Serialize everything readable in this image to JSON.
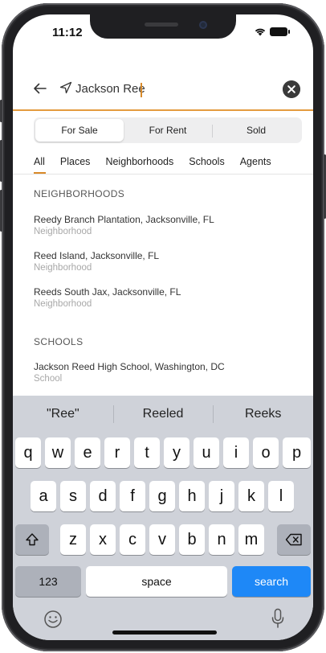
{
  "status_bar": {
    "time": "11:12"
  },
  "search": {
    "value": "Jackson Ree"
  },
  "segments": [
    {
      "label": "For Sale",
      "active": true
    },
    {
      "label": "For Rent",
      "active": false
    },
    {
      "label": "Sold",
      "active": false
    }
  ],
  "tabs": [
    {
      "label": "All",
      "active": true
    },
    {
      "label": "Places",
      "active": false
    },
    {
      "label": "Neighborhoods",
      "active": false
    },
    {
      "label": "Schools",
      "active": false
    },
    {
      "label": "Agents",
      "active": false
    }
  ],
  "sections": {
    "neighborhoods": {
      "heading": "NEIGHBORHOODS",
      "items": [
        {
          "title": "Reedy Branch Plantation, Jacksonville, FL",
          "type": "Neighborhood"
        },
        {
          "title": "Reed Island, Jacksonville, FL",
          "type": "Neighborhood"
        },
        {
          "title": "Reeds South Jax, Jacksonville, FL",
          "type": "Neighborhood"
        }
      ]
    },
    "schools": {
      "heading": "SCHOOLS",
      "items": [
        {
          "title": "Jackson Reed High School, Washington, DC",
          "type": "School"
        }
      ]
    }
  },
  "keyboard": {
    "suggestions": [
      "\"Ree\"",
      "Reeled",
      "Reeks"
    ],
    "row1": [
      "q",
      "w",
      "e",
      "r",
      "t",
      "y",
      "u",
      "i",
      "o",
      "p"
    ],
    "row2": [
      "a",
      "s",
      "d",
      "f",
      "g",
      "h",
      "j",
      "k",
      "l"
    ],
    "row3": [
      "z",
      "x",
      "c",
      "v",
      "b",
      "n",
      "m"
    ],
    "numbers_label": "123",
    "space_label": "space",
    "search_label": "search"
  },
  "colors": {
    "accent_orange": "#e49b3f",
    "keyboard_blue": "#1e88f7"
  },
  "icons": [
    "back-arrow-icon",
    "navigation-arrow-icon",
    "clear-icon",
    "shift-icon",
    "delete-icon",
    "emoji-icon",
    "microphone-icon",
    "wifi-icon",
    "battery-icon"
  ]
}
